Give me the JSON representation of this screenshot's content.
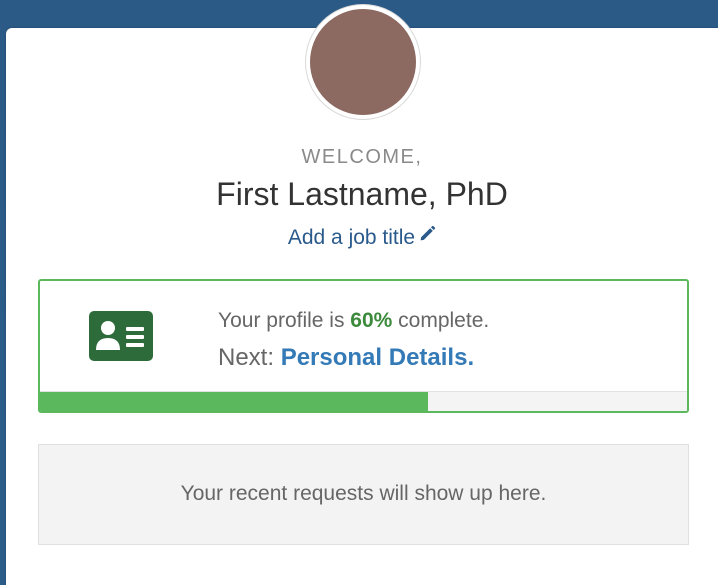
{
  "welcome": {
    "greeting": "WELCOME,",
    "user_name": "First Lastname, PhD",
    "job_title_link": "Add a job title",
    "pencil_icon": "pencil-icon"
  },
  "profile": {
    "icon": "id-card-icon",
    "prefix": "Your profile is ",
    "percent": "60%",
    "suffix": " complete.",
    "next_label": "Next: ",
    "next_link": "Personal Details.",
    "progress_fraction": 0.6,
    "accent_color": "#5cb85c"
  },
  "requests": {
    "empty_message": "Your recent requests will show up here."
  }
}
